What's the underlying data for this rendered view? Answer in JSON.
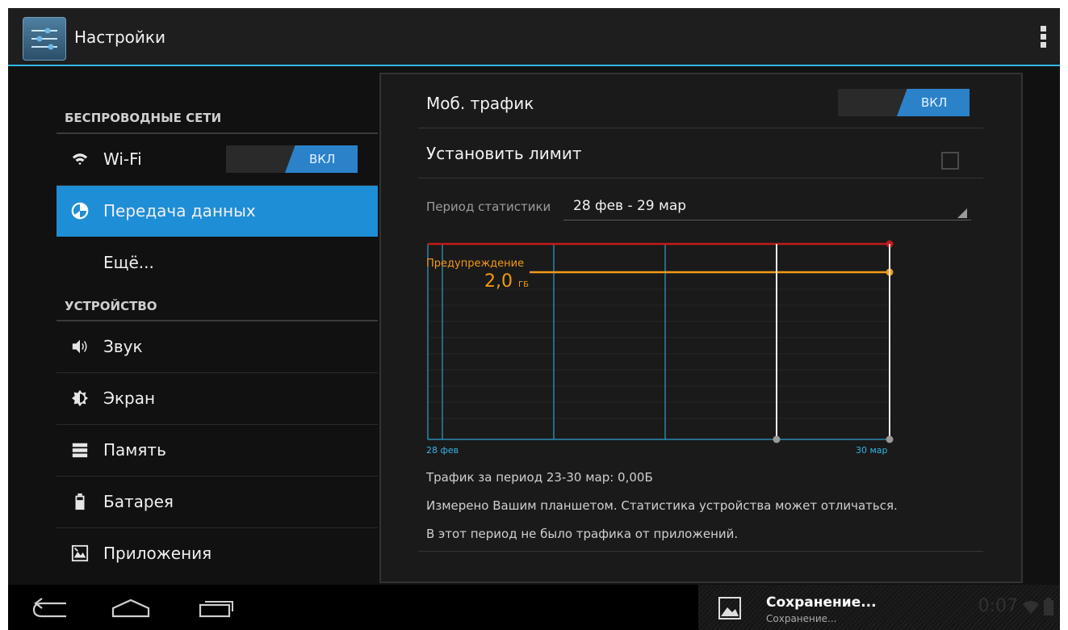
{
  "app": {
    "title": "Настройки"
  },
  "sidebar": {
    "section_wireless": "БЕСПРОВОДНЫЕ СЕТИ",
    "section_device": "УСТРОЙСТВО",
    "items": [
      {
        "label": "Wi-Fi",
        "icon": "wifi-icon",
        "toggle": "ВКЛ"
      },
      {
        "label": "Передача данных",
        "icon": "data-usage-icon",
        "selected": true
      },
      {
        "label": "Ещё..."
      },
      {
        "label": "Звук",
        "icon": "volume-icon"
      },
      {
        "label": "Экран",
        "icon": "brightness-icon"
      },
      {
        "label": "Память",
        "icon": "storage-icon"
      },
      {
        "label": "Батарея",
        "icon": "battery-icon"
      },
      {
        "label": "Приложения",
        "icon": "apps-icon"
      }
    ]
  },
  "main": {
    "mobile_traffic": {
      "label": "Моб. трафик",
      "toggle": "ВКЛ"
    },
    "set_limit": {
      "label": "Установить лимит",
      "checked": false
    },
    "period": {
      "label": "Период статистики",
      "value": "28 фев - 29 мар"
    },
    "warning": {
      "label": "Предупреждение",
      "value": "2,0",
      "unit": "ГБ"
    },
    "axis": {
      "start": "28 фев",
      "end": "30 мар"
    },
    "info_lines": [
      "Трафик за период 23-30 мар: 0,00Б",
      "Измерено Вашим планшетом. Статистика устройства может отличаться.",
      "В этот период не было трафика от приложений."
    ]
  },
  "notification": {
    "title": "Сохранение...",
    "subtitle": "Сохранение...",
    "time": "0:07"
  },
  "colors": {
    "accent": "#33b5e5",
    "selected": "#1e8ed6",
    "limit": "#c21a1a",
    "warning": "#f39a17"
  }
}
